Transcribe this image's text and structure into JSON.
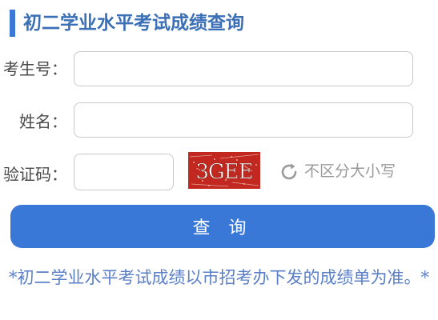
{
  "page": {
    "title": "初二学业水平考试成绩查询"
  },
  "form": {
    "exam_no_label": "考生号：",
    "exam_no_value": "",
    "name_label": "姓名：",
    "name_value": "",
    "captcha_label": "验证码：",
    "captcha_value": "",
    "captcha_text": "3GEE",
    "refresh_icon": "refresh-icon",
    "case_note": "不区分大小写",
    "submit_label": "查 询"
  },
  "footer": {
    "note": "*初二学业水平考试成绩以市招考办下发的成绩单为准。*"
  },
  "colors": {
    "accent": "#3a78d8",
    "title": "#3b6fb6",
    "footnote": "#5b7fc7",
    "captcha_bg": "#c2281f"
  }
}
